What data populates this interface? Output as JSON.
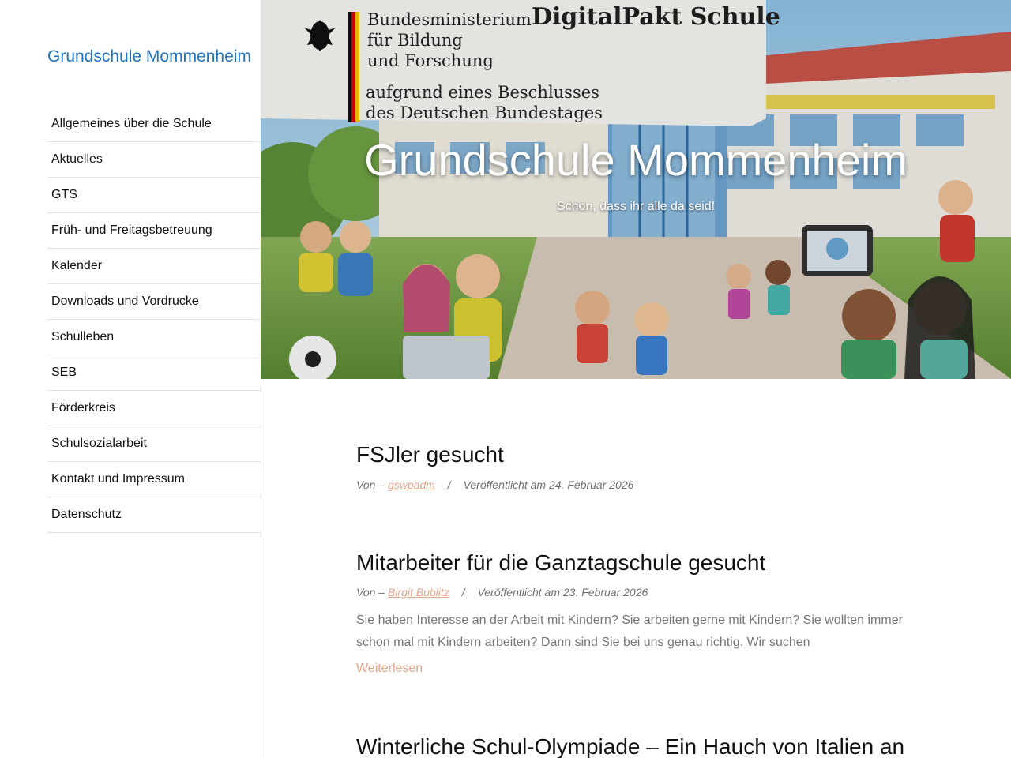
{
  "site": {
    "title": "Grundschule Mommenheim"
  },
  "nav": {
    "items": [
      {
        "label": "Allgemeines über die Schule"
      },
      {
        "label": "Aktuelles"
      },
      {
        "label": "GTS"
      },
      {
        "label": "Früh- und Freitagsbetreuung"
      },
      {
        "label": "Kalender"
      },
      {
        "label": "Downloads und Vordrucke"
      },
      {
        "label": "Schulleben"
      },
      {
        "label": "SEB"
      },
      {
        "label": "Förderkreis"
      },
      {
        "label": "Schulsozialarbeit"
      },
      {
        "label": "Kontakt und Impressum"
      },
      {
        "label": "Datenschutz"
      }
    ]
  },
  "hero": {
    "title": "Grundschule Mommenheim",
    "tagline": "Schön, dass ihr alle da seid!",
    "banner": {
      "ministry_line1": "Bundesministerium",
      "ministry_line2": "für Bildung",
      "ministry_line3": "und Forschung",
      "program": "DigitalPakt Schule",
      "decision_line1": "aufgrund eines Beschlusses",
      "decision_line2": "des Deutschen Bundestages"
    }
  },
  "posts": [
    {
      "title": "FSJler gesucht",
      "by_label": "Von –",
      "author": "gswpadm",
      "separator": "/",
      "published": "Veröffentlicht am 24. Februar 2026"
    },
    {
      "title": "Mitarbeiter für die Ganztagschule gesucht",
      "by_label": "Von –",
      "author": "Birgit Bublitz",
      "separator": "/",
      "published": "Veröffentlicht am 23. Februar 2026",
      "excerpt": "Sie haben Interesse an der Arbeit mit Kindern? Sie arbeiten gerne mit Kindern? Sie wollten immer schon mal mit Kindern arbeiten? Dann sind Sie bei uns genau richtig. Wir suchen",
      "more_label": "Weiterlesen"
    },
    {
      "title": "Winterliche Schul-Olympiade – Ein Hauch von Italien an"
    }
  ],
  "colors": {
    "link": "#1e73be",
    "accent": "#e0a78c",
    "muted": "#757575"
  }
}
